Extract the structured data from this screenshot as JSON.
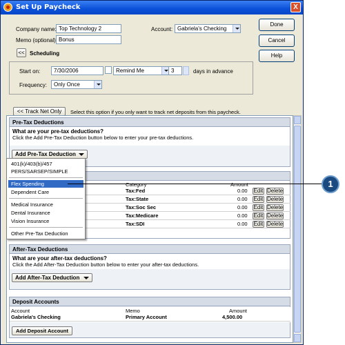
{
  "window": {
    "title": "Set Up Paycheck",
    "close_label": "X"
  },
  "form": {
    "company_label": "Company name:",
    "company_value": "Top Technology 2",
    "memo_label": "Memo (optional):",
    "memo_value": "Bonus",
    "account_label": "Account:",
    "account_value": "Gabriela's Checking"
  },
  "actions": {
    "done": "Done",
    "cancel": "Cancel",
    "help": "Help"
  },
  "scheduling": {
    "collapse_label": "<<",
    "title": "Scheduling",
    "start_label": "Start on:",
    "start_value": "7/30/2006",
    "remind_value": "Remind Me",
    "days_value": "3",
    "days_label": "days in advance",
    "frequency_label": "Frequency:",
    "frequency_value": "Only Once"
  },
  "track_net": {
    "button_label": "<< Track Net Only",
    "hint": "Select this option if you only want to track net deposits from this paycheck."
  },
  "pretax": {
    "title": "Pre-Tax Deductions",
    "question": "What are your pre-tax deductions?",
    "instruction": "Click the Add Pre-Tax Deduction button below to enter your pre-tax deductions.",
    "add_button": "Add Pre-Tax Deduction"
  },
  "menu": {
    "items": [
      "401(k)/403(b)/457",
      "PERS/SARSEP/SIMPLE",
      "Flex Spending",
      "Dependent Care",
      "Medical Insurance",
      "Dental Insurance",
      "Vision Insurance",
      "Other Pre-Tax Deduction"
    ]
  },
  "taxes": {
    "columns": {
      "category": "Category",
      "amount": "Amount"
    },
    "edit_label": "Edit",
    "delete_label": "Delete",
    "rows": [
      {
        "category": "Tax:Fed",
        "amount": "0.00"
      },
      {
        "category": "Tax:State",
        "amount": "0.00"
      },
      {
        "category": "Tax:Soc Sec",
        "amount": "0.00"
      },
      {
        "category": "Tax:Medicare",
        "amount": "0.00"
      },
      {
        "category": "Tax:SDI",
        "amount": "0.00"
      }
    ]
  },
  "aftertax": {
    "title": "After-Tax Deductions",
    "question": "What are your after-tax deductions?",
    "instruction": "Click the Add After-Tax Deduction button below to enter your after-tax deductions.",
    "add_button": "Add After-Tax Deduction"
  },
  "deposit": {
    "title": "Deposit Accounts",
    "columns": {
      "account": "Account",
      "memo": "Memo",
      "amount": "Amount"
    },
    "row": {
      "account": "Gabriela's Checking",
      "memo": "Primary Account",
      "amount": "4,500.00"
    },
    "add_button": "Add Deposit Account"
  },
  "callout": {
    "number": "1"
  },
  "colors": {
    "title_bar": "#0a50d8",
    "selection": "#316ac5",
    "callout": "#1a4a80"
  }
}
